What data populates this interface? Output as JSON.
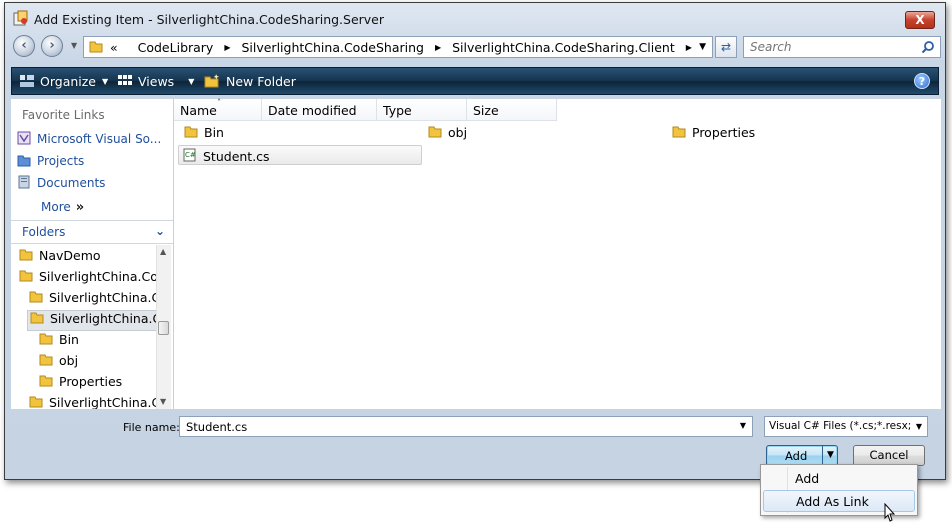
{
  "window": {
    "title": "Add Existing Item - SilverlightChina.CodeSharing.Server",
    "close_glyph": "X"
  },
  "address": {
    "overflow_glyph": "«",
    "crumbs": [
      "CodeLibrary",
      "SilverlightChina.CodeSharing",
      "SilverlightChina.CodeSharing.Client"
    ],
    "search_placeholder": "Search"
  },
  "toolbar": {
    "organize_label": "Organize",
    "views_label": "Views",
    "new_folder_label": "New Folder",
    "help_glyph": "?"
  },
  "sidebar": {
    "favorites_header": "Favorite Links",
    "favorites": [
      {
        "label": "Microsoft Visual So...",
        "icon": "visual-studio-icon"
      },
      {
        "label": "Projects",
        "icon": "projects-folder-icon"
      },
      {
        "label": "Documents",
        "icon": "documents-icon"
      }
    ],
    "more_label": "More",
    "folders_header": "Folders",
    "tree": [
      {
        "label": "NavDemo"
      },
      {
        "label": "SilverlightChina.Co"
      },
      {
        "label": "SilverlightChina.C"
      },
      {
        "label": "SilverlightChina.C",
        "selected": true
      },
      {
        "label": "Bin"
      },
      {
        "label": "obj"
      },
      {
        "label": "Properties"
      },
      {
        "label": "SilverlightChina.C"
      }
    ]
  },
  "columns": [
    "Name",
    "Date modified",
    "Type",
    "Size"
  ],
  "files": [
    {
      "label": "Bin",
      "type": "folder"
    },
    {
      "label": "obj",
      "type": "folder"
    },
    {
      "label": "Properties",
      "type": "folder"
    },
    {
      "label": "Student.cs",
      "type": "csharp-file",
      "selected": true
    }
  ],
  "bottom": {
    "file_name_label": "File name:",
    "file_name_value": "Student.cs",
    "file_type_value": "Visual C# Files (*.cs;*.resx;*.settings;*.xsd;*.wsdl)",
    "add_label": "Add",
    "cancel_label": "Cancel"
  },
  "add_menu": [
    "Add",
    "Add As Link"
  ],
  "colors": {
    "toolbar_bg": "#163550",
    "link_blue": "#1f4f9c",
    "folder_yellow": "#f2c43d",
    "add_button_blue": "#98d1ef"
  }
}
